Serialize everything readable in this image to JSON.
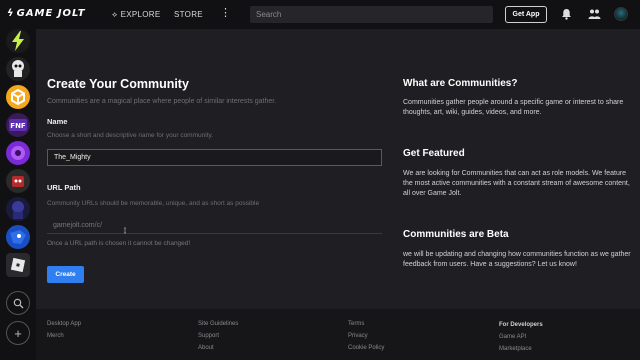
{
  "topbar": {
    "logo_text": "GAME JOLT",
    "nav": {
      "explore": "EXPLORE",
      "store": "STORE"
    },
    "search_placeholder": "Search",
    "get_app": "Get App"
  },
  "form": {
    "title": "Create Your Community",
    "subtitle": "Communities are a magical place where people of similar interests gather.",
    "name_label": "Name",
    "name_hint": "Choose a short and descriptive name for your community.",
    "name_value": "The_Mighty",
    "url_label": "URL Path",
    "url_hint": "Community URLs should be memorable, unique, and as short as possible",
    "url_value": "gamejolt.com/c/",
    "url_warning": "Once a URL path is chosen it cannot be changed!",
    "create_button": "Create"
  },
  "info": {
    "what_title": "What are Communities?",
    "what_text": "Communities gather people around a specific game or interest to share thoughts, art, wiki, guides, videos, and more.",
    "featured_title": "Get Featured",
    "featured_text": "We are looking for Communities that can act as role models. We feature the most active communities with a constant stream of awesome content, all over Game Jolt.",
    "beta_title": "Communities are Beta",
    "beta_text": "we will be updating and changing how communities function as we gather feedback from users. Have a suggestions? Let us know!"
  },
  "footer": {
    "col1": [
      "Desktop App",
      "Merch"
    ],
    "col2": [
      "Site Guidelines",
      "Support",
      "About"
    ],
    "col3": [
      "Terms",
      "Privacy",
      "Cookie Policy"
    ],
    "col4_title": "For Developers",
    "col4": [
      "Game API",
      "Marketplace"
    ]
  },
  "colors": {
    "accent": "#2f7ff0",
    "background": "#1f1f23",
    "topbar": "#111114"
  }
}
